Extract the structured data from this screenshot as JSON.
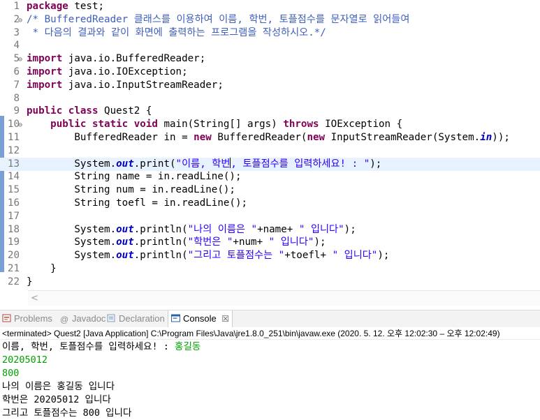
{
  "editor": {
    "lines": [
      {
        "n": "1",
        "segs": [
          [
            "kw",
            "package"
          ],
          [
            "",
            "test;"
          ]
        ]
      },
      {
        "n": "2",
        "fold": "⊖",
        "segs": [
          [
            "cm",
            "/* BufferedReader 클래스를 이용하여 이름, 학번, 토플점수를 문자열로 읽어들여"
          ]
        ]
      },
      {
        "n": "3",
        "segs": [
          [
            "cm",
            " * 다음의 결과와 같이 화면에 출력하는 프로그램을 작성하시오.*/"
          ]
        ]
      },
      {
        "n": "4",
        "segs": []
      },
      {
        "n": "5",
        "fold": "⊖",
        "segs": [
          [
            "kw",
            "import"
          ],
          [
            "",
            "java.io.BufferedReader;"
          ]
        ]
      },
      {
        "n": "6",
        "segs": [
          [
            "kw",
            "import"
          ],
          [
            "",
            "java.io.IOException;"
          ]
        ]
      },
      {
        "n": "7",
        "segs": [
          [
            "kw",
            "import"
          ],
          [
            "",
            "java.io.InputStreamReader;"
          ]
        ]
      },
      {
        "n": "8",
        "segs": []
      },
      {
        "n": "9",
        "segs": [
          [
            "kw",
            "public class"
          ],
          [
            "",
            "Quest2 {"
          ]
        ]
      },
      {
        "n": "10",
        "fold": "⊖",
        "segs": [
          [
            "",
            "    "
          ],
          [
            "kw",
            "public static void"
          ],
          [
            "",
            "main(String[] args) "
          ],
          [
            "kw",
            "throws"
          ],
          [
            "",
            "IOException {"
          ]
        ]
      },
      {
        "n": "11",
        "segs": [
          [
            "",
            "        BufferedReader in = "
          ],
          [
            "kw",
            "new"
          ],
          [
            "",
            "BufferedReader("
          ],
          [
            "kw",
            "new"
          ],
          [
            "",
            "InputStreamReader(System."
          ],
          [
            "fld",
            "in"
          ],
          [
            "",
            "));"
          ]
        ]
      },
      {
        "n": "12",
        "segs": []
      },
      {
        "n": "13",
        "current": true,
        "segs": [
          [
            "",
            "        System."
          ],
          [
            "fld",
            "out"
          ],
          [
            "",
            ".print("
          ],
          [
            "st",
            "\"이름, 학번"
          ],
          [
            "caret",
            ""
          ],
          [
            "st",
            ", 토플점수를 입력하세요! : \""
          ],
          [
            "",
            ");"
          ]
        ]
      },
      {
        "n": "14",
        "segs": [
          [
            "",
            "        String name = in.readLine();"
          ]
        ]
      },
      {
        "n": "15",
        "segs": [
          [
            "",
            "        String num = in.readLine();"
          ]
        ]
      },
      {
        "n": "16",
        "segs": [
          [
            "",
            "        String toefl = in.readLine();"
          ]
        ]
      },
      {
        "n": "17",
        "segs": []
      },
      {
        "n": "18",
        "segs": [
          [
            "",
            "        System."
          ],
          [
            "fld",
            "out"
          ],
          [
            "",
            ".println("
          ],
          [
            "st",
            "\"나의 이름은 \""
          ],
          [
            "",
            "+name+ "
          ],
          [
            "st",
            "\" 입니다\""
          ],
          [
            "",
            ");"
          ]
        ]
      },
      {
        "n": "19",
        "segs": [
          [
            "",
            "        System."
          ],
          [
            "fld",
            "out"
          ],
          [
            "",
            ".println("
          ],
          [
            "st",
            "\"학번은 \""
          ],
          [
            "",
            "+num+ "
          ],
          [
            "st",
            "\" 입니다\""
          ],
          [
            "",
            ");"
          ]
        ]
      },
      {
        "n": "20",
        "segs": [
          [
            "",
            "        System."
          ],
          [
            "fld",
            "out"
          ],
          [
            "",
            ".println("
          ],
          [
            "st",
            "\"그리고 토플점수는 \""
          ],
          [
            "",
            "+toefl+ "
          ],
          [
            "st",
            "\" 입니다\""
          ],
          [
            "",
            ");"
          ]
        ]
      },
      {
        "n": "21",
        "segs": [
          [
            "",
            "    }"
          ]
        ]
      },
      {
        "n": "22",
        "segs": [
          [
            "",
            "}"
          ]
        ]
      }
    ],
    "hscroll_arrow": "<"
  },
  "tabs": [
    {
      "label": "Problems",
      "icon": "problems-icon",
      "active": false
    },
    {
      "label": "Javadoc",
      "icon": "javadoc-icon",
      "active": false
    },
    {
      "label": "Declaration",
      "icon": "declaration-icon",
      "active": false
    },
    {
      "label": "Console",
      "icon": "console-icon",
      "active": true,
      "close": "☒"
    }
  ],
  "console": {
    "status": "<terminated> Quest2 [Java Application] C:\\Program Files\\Java\\jre1.8.0_251\\bin\\javaw.exe  (2020. 5. 12. 오후 12:02:30 – 오후 12:02:49)",
    "prompt": "이름, 학번, 토플점수를 입력하세요! : ",
    "prompt_input": "홍길동",
    "inputs": [
      "20205012",
      "800"
    ],
    "output": [
      "나의 이름은 홍길동 입니다",
      "학번은 20205012 입니다",
      "그리고 토플점수는 800 입니다"
    ]
  },
  "colors": {
    "keyword": "#7f0055",
    "comment": "#3f5fbf",
    "string": "#2a00ff",
    "field": "#0000c0",
    "console_input": "#00a000"
  }
}
